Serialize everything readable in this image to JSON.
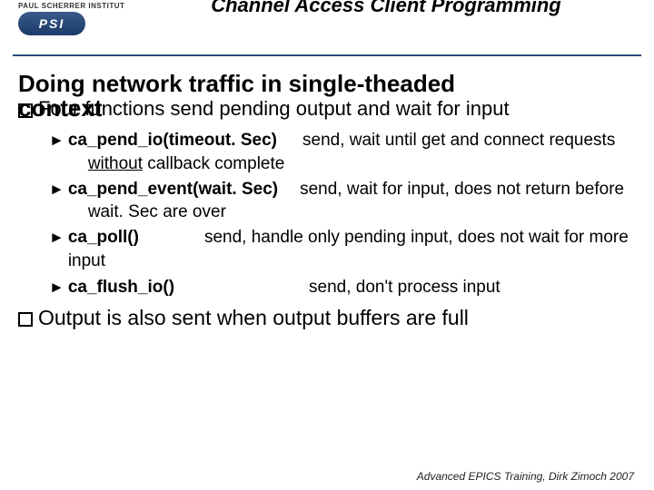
{
  "logo": {
    "institute": "PAUL SCHERRER INSTITUT",
    "abbrev": "PSI"
  },
  "header_title": "Channel Access Client Programming",
  "slide_title_line1": "Doing network traffic in single-theaded",
  "slide_title_context": "context",
  "bullet1": "Four functions send pending output and wait for input",
  "funcs": {
    "f1": {
      "name": "ca_pend_io(timeout. Sec)",
      "desc1": "send, wait until get and connect requests",
      "desc2_prefix": "without",
      "desc2_rest": " callback complete"
    },
    "f2": {
      "name": "ca_pend_event(wait. Sec)",
      "desc1": "send, wait for input, does not return before",
      "desc2": "wait. Sec are over"
    },
    "f3": {
      "name": "ca_poll()",
      "desc": "send, handle only pending input, does not wait for more input"
    },
    "f4": {
      "name": "ca_flush_io()",
      "desc": "send, don't process input"
    }
  },
  "bullet2": "Output is also sent when output buffers are full",
  "footer": "Advanced EPICS Training, Dirk Zimoch 2007"
}
